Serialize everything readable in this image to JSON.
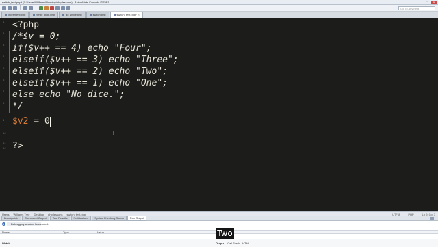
{
  "window": {
    "title": "switch_test.php* (C:\\Users\\Williams\\Desktop\\php lessons) - ActiveState Komodo IDE 8.5",
    "controls": [
      "–",
      "□",
      "✕"
    ]
  },
  "toolbar": {
    "go_to_placeholder": "Go To Anything"
  },
  "tabs": [
    {
      "label": "increment.php",
      "active": false
    },
    {
      "label": "while_loop.php",
      "active": false
    },
    {
      "label": "do_while.php",
      "active": false
    },
    {
      "label": "switch.php",
      "active": false
    },
    {
      "label": "switch_test.php*",
      "active": true
    }
  ],
  "editor": {
    "line_numbers": [
      "1",
      "2",
      "3",
      "4",
      "5",
      "6",
      "7",
      "8",
      "9",
      "10",
      "11",
      "12"
    ],
    "lines": [
      {
        "plain": "<?php"
      },
      {
        "plain": "/*$v = 0;"
      },
      {
        "plain": "if($v++ == 4) echo \"Four\";"
      },
      {
        "plain": "elseif($v++ == 3) echo \"Three\";"
      },
      {
        "plain": "elseif($v++ == 2) echo \"Two\";"
      },
      {
        "plain": "elseif($v++ == 1) echo \"One\";"
      },
      {
        "plain": "else echo \"No dice.\";"
      },
      {
        "plain": "*/"
      },
      {
        "var": "$v2",
        "rest": " = 0"
      },
      {
        "plain": ""
      },
      {
        "plain": ""
      },
      {
        "plain": "?>"
      }
    ],
    "colors": {
      "background": "#1c1d1a",
      "text": "#e6e3d6",
      "variable": "#d67a35",
      "gutter": "#6f7064"
    }
  },
  "status": {
    "breadcrumbs": [
      "Users",
      "Williams Tree",
      "Desktop",
      "php lessons",
      "switch_test.php"
    ],
    "position": "Ln 9, Col 7",
    "language": "PHP",
    "encoding": "UTF-8"
  },
  "bottom_tabs": [
    {
      "label": "Breakpoints",
      "active": false
    },
    {
      "label": "Command Output",
      "active": false
    },
    {
      "label": "Test Results",
      "active": false
    },
    {
      "label": "Notifications",
      "active": false
    },
    {
      "label": "Syntax Checking Status",
      "active": false
    },
    {
      "label": "Run Output",
      "active": true
    }
  ],
  "output": {
    "message": "Debugging session has ended.",
    "columns": [
      "Name",
      "Type",
      "Value"
    ],
    "watch_label": "Watch",
    "output_tabs": [
      "Output",
      "Call Stack",
      "HTML"
    ],
    "overlay_text": "Two"
  }
}
